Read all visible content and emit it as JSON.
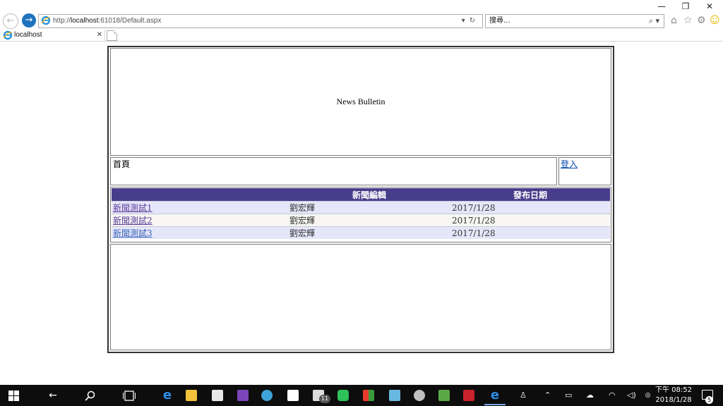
{
  "window": {
    "minimize": "—",
    "restore": "❐",
    "close": "✕"
  },
  "browser": {
    "address_prefix": "http://",
    "address_host": "localhost",
    "address_rest": ":61018/Default.aspx",
    "search_placeholder": "搜尋...",
    "tab_title": "localhost",
    "tab_close": "✕",
    "icons": {
      "refresh": "↻",
      "dropdown": "▾",
      "search": "⌕",
      "home": "⌂",
      "favorites": "☆",
      "settings": "⚙",
      "smiley": "☺"
    },
    "accent_color": "#1e73be"
  },
  "page": {
    "banner_title": "News Bulletin",
    "nav_home": "首頁",
    "nav_login": "登入",
    "grid": {
      "headers": [
        "",
        "新聞編輯",
        "發布日期"
      ],
      "rows": [
        {
          "title": "新聞測試1",
          "editor": "劉宏輝",
          "date": "2017/1/28"
        },
        {
          "title": "新聞測試2",
          "editor": "劉宏輝",
          "date": "2017/1/28"
        },
        {
          "title": "新聞測試3",
          "editor": "劉宏輝",
          "date": "2017/1/28"
        }
      ],
      "header_color": "#483d8b"
    }
  },
  "taskbar": {
    "mail_badge": "11",
    "clock_time": "下午 08:52",
    "clock_date": "2018/1/28",
    "notification_count": "5"
  }
}
